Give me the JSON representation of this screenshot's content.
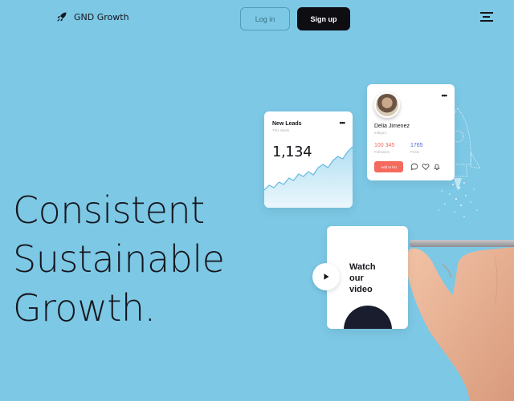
{
  "header": {
    "brand_name": "GND Growth",
    "brand_icon": "rocket-icon",
    "login_label": "Log in",
    "signup_label": "Sign up",
    "menu_icon": "menu-icon"
  },
  "hero": {
    "lines": [
      "Consistent",
      "Sustainable",
      "Growth."
    ]
  },
  "leads_card": {
    "title": "New Leads",
    "subtitle": "This Week",
    "value": "1,134",
    "menu_icon": "more-dots-icon",
    "trend": [
      8,
      14,
      11,
      18,
      15,
      23,
      20,
      28,
      25,
      31,
      27,
      36,
      40,
      36,
      45,
      50,
      47,
      56,
      62
    ]
  },
  "profile_card": {
    "name": "Delia Jimenez",
    "role": "Indigo’s",
    "followers_value": "100 345",
    "followers_label": "Followers",
    "posts_value": "1765",
    "posts_label": "Posts",
    "add_label": "Add to list",
    "menu_icon": "more-dots-icon",
    "action_icons": [
      "comment-icon",
      "heart-icon",
      "bell-icon"
    ]
  },
  "video_card": {
    "text": [
      "Watch",
      "our",
      "video"
    ],
    "play_icon": "play-icon"
  },
  "colors": {
    "background": "#7cc8e5",
    "accent_dark": "#0d0d12",
    "followers": "#f46a5d",
    "posts": "#5a68d6",
    "chart_line": "#63b8e0"
  }
}
